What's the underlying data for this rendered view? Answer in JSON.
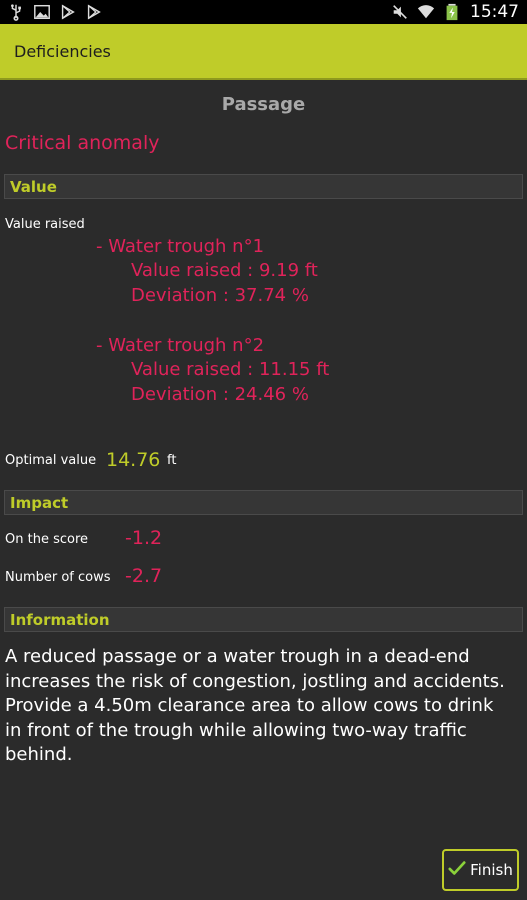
{
  "status_bar": {
    "time": "15:47",
    "icons": [
      "usb-icon",
      "image-icon",
      "play-store-icon",
      "play-store-icon",
      "mute-icon",
      "wifi-icon",
      "battery-charging-icon"
    ]
  },
  "action_bar": {
    "title": "Deficiencies"
  },
  "page": {
    "title": "Passage",
    "severity": "Critical anomaly"
  },
  "value_section": {
    "header": "Value",
    "raised_label": "Value raised",
    "troughs": [
      {
        "name": "- Water trough n°1",
        "raised": "Value raised : 9.19 ft",
        "deviation": "Deviation : 37.74 %"
      },
      {
        "name": "- Water trough n°2",
        "raised": "Value raised : 11.15 ft",
        "deviation": "Deviation : 24.46 %"
      }
    ],
    "optimal_label": "Optimal value",
    "optimal_value": "14.76",
    "optimal_unit": "ft"
  },
  "impact_section": {
    "header": "Impact",
    "score_label": "On the score",
    "score_value": "-1.2",
    "cows_label": "Number of cows",
    "cows_value": "-2.7"
  },
  "information_section": {
    "header": "Information",
    "text": "A reduced passage or a water trough in a dead-end increases the risk of congestion, jostling and accidents. Provide a 4.50m clearance area to allow cows to drink in front of the trough while allowing two-way traffic behind."
  },
  "footer": {
    "finish_label": "Finish"
  },
  "colors": {
    "accent": "#bfcc29",
    "critical": "#e0235a",
    "background": "#2b2b2b",
    "section_bg": "#363636"
  }
}
